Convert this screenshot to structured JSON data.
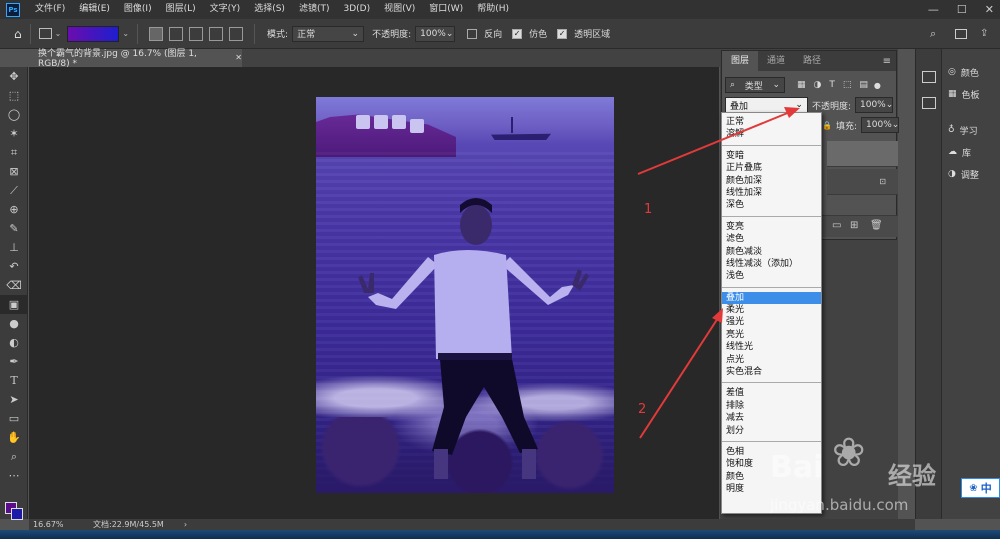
{
  "menubar": {
    "items": [
      "文件(F)",
      "编辑(E)",
      "图像(I)",
      "图层(L)",
      "文字(Y)",
      "选择(S)",
      "滤镜(T)",
      "3D(D)",
      "视图(V)",
      "窗口(W)",
      "帮助(H)"
    ],
    "window_controls": [
      "—",
      "☐",
      "✕"
    ]
  },
  "options": {
    "mode_label": "模式:",
    "mode_value": "正常",
    "opacity_label": "不透明度:",
    "opacity_value": "100%",
    "reverse_label": "反向",
    "dither_label": "仿色",
    "transparency_label": "透明区域"
  },
  "document": {
    "tab_title": "换个霸气的背景.jpg @ 16.7% (图层 1, RGB/8) *",
    "close": "✕"
  },
  "status": {
    "zoom": "16.67%",
    "doc_size": "文档:22.9M/45.5M"
  },
  "layers_panel": {
    "tabs": [
      "图层",
      "通道",
      "路径"
    ],
    "filter_label": "类型",
    "blend_value": "叠加",
    "opacity_label": "不透明度:",
    "opacity_value": "100%",
    "fill_label": "填充:",
    "fill_value": "100%"
  },
  "blend_modes": {
    "group1": [
      "正常",
      "溶解"
    ],
    "group2": [
      "变暗",
      "正片叠底",
      "颜色加深",
      "线性加深",
      "深色"
    ],
    "group3": [
      "变亮",
      "滤色",
      "颜色减淡",
      "线性减淡（添加）",
      "浅色"
    ],
    "group4": [
      "叠加",
      "柔光",
      "强光",
      "亮光",
      "线性光",
      "点光",
      "实色混合"
    ],
    "group5": [
      "差值",
      "排除",
      "减去",
      "划分"
    ],
    "group6": [
      "色相",
      "饱和度",
      "颜色",
      "明度"
    ],
    "selected": "叠加"
  },
  "dock": {
    "items": [
      "颜色",
      "色板",
      "学习",
      "库",
      "调整"
    ]
  },
  "annotations": [
    "1",
    "2"
  ],
  "watermark": {
    "brand": "Bai",
    "brand_cn": "经验",
    "url": "jingyan.baidu.com"
  },
  "ime": {
    "label": "中"
  },
  "colors": {
    "accent": "#3d8ee8",
    "annotation": "#e23a3a",
    "foreground": "#5b0c8c",
    "background": "#1c1ca8"
  }
}
